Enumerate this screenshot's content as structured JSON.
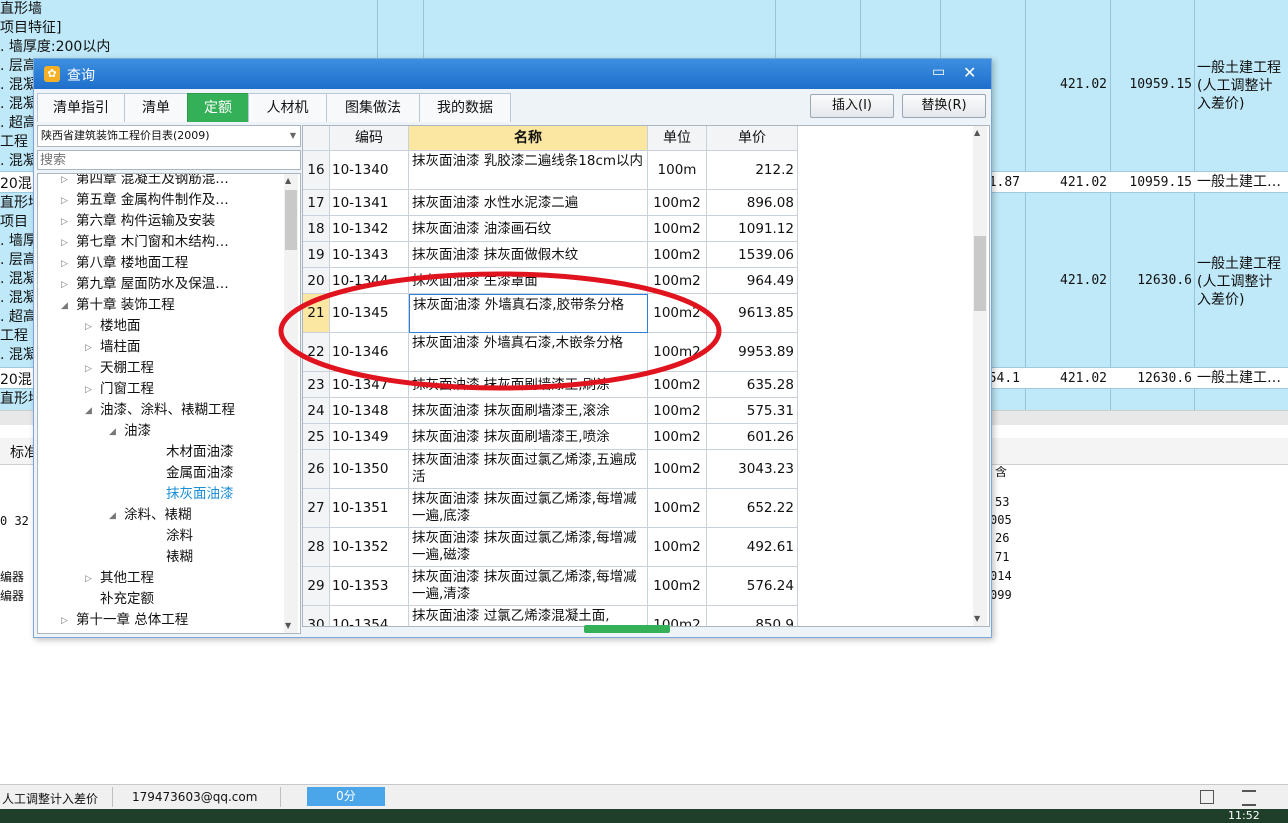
{
  "background": {
    "left_texts": [
      "直形墙",
      "项目特征]",
      ". 墙厚度:200以内",
      ". 层高",
      ". 混凝",
      ". 混凝",
      ". 超高",
      "工程",
      ". 混凝",
      "20混",
      "直形墙",
      "项目",
      ". 墙厚",
      ". 层高",
      ". 混凝",
      ". 混凝",
      ". 超高",
      "工程",
      ". 混凝",
      "20混",
      "直形墙"
    ],
    "rows": [
      {
        "col_a": "",
        "price": "421.02",
        "total": "10959.15",
        "desc": "一般土建工程\n(人工调整计\n入差价)"
      },
      {
        "col_a": "1.87",
        "price": "421.02",
        "total": "10959.15",
        "desc": "一般土建工…"
      },
      {
        "col_a": "",
        "price": "421.02",
        "total": "12630.6",
        "desc": "一般土建工程\n(人工调整计\n入差价)"
      },
      {
        "col_a": "54.1",
        "price": "421.02",
        "total": "12630.6",
        "desc": "一般土建工…"
      }
    ],
    "lower_tab": "标准",
    "lower_left": [
      "0 32",
      "编器",
      "编器"
    ],
    "lower_right": [
      "含",
      "53",
      "005",
      "26",
      "71",
      "014",
      "099"
    ]
  },
  "statusbar": {
    "left_text": "人工调整计入差价",
    "email": "179473603@qq.com",
    "progress_text": "0分",
    "clock": "11:52"
  },
  "dialog": {
    "title": "查询",
    "tabs": [
      {
        "label": "清单指引",
        "active": false
      },
      {
        "label": "清单",
        "active": false
      },
      {
        "label": "定额",
        "active": true
      },
      {
        "label": "人材机",
        "active": false
      },
      {
        "label": "图集做法",
        "active": false
      },
      {
        "label": "我的数据",
        "active": false
      }
    ],
    "insert_button": "插入(I)",
    "replace_button": "替换(R)",
    "catalog": "陕西省建筑装饰工程价目表(2009)",
    "search_placeholder": "搜索",
    "tree": [
      {
        "label": "第四章  混凝土及钢筋混…",
        "level": 1,
        "expand": "collapsed"
      },
      {
        "label": "第五章  金属构件制作及…",
        "level": 1,
        "expand": "collapsed"
      },
      {
        "label": "第六章  构件运输及安装",
        "level": 1,
        "expand": "collapsed"
      },
      {
        "label": "第七章  木门窗和木结构…",
        "level": 1,
        "expand": "collapsed"
      },
      {
        "label": "第八章  楼地面工程",
        "level": 1,
        "expand": "collapsed"
      },
      {
        "label": "第九章  屋面防水及保温…",
        "level": 1,
        "expand": "collapsed"
      },
      {
        "label": "第十章  装饰工程",
        "level": 1,
        "expand": "expanded"
      },
      {
        "label": "楼地面",
        "level": 2,
        "expand": "collapsed"
      },
      {
        "label": "墙柱面",
        "level": 2,
        "expand": "collapsed"
      },
      {
        "label": "天棚工程",
        "level": 2,
        "expand": "collapsed"
      },
      {
        "label": "门窗工程",
        "level": 2,
        "expand": "collapsed"
      },
      {
        "label": "油漆、涂料、裱糊工程",
        "level": 2,
        "expand": "expanded"
      },
      {
        "label": "油漆",
        "level": 3,
        "expand": "expanded"
      },
      {
        "label": "木材面油漆",
        "level": 4,
        "expand": "none"
      },
      {
        "label": "金属面油漆",
        "level": 4,
        "expand": "none"
      },
      {
        "label": "抹灰面油漆",
        "level": 4,
        "expand": "none",
        "selected": true
      },
      {
        "label": "涂料、裱糊",
        "level": 3,
        "expand": "expanded"
      },
      {
        "label": "涂料",
        "level": 4,
        "expand": "none"
      },
      {
        "label": "裱糊",
        "level": 4,
        "expand": "none"
      },
      {
        "label": "其他工程",
        "level": 2,
        "expand": "collapsed"
      },
      {
        "label": "补充定额",
        "level": 2,
        "expand": "none"
      },
      {
        "label": "第十一章  总体工程",
        "level": 1,
        "expand": "collapsed"
      }
    ],
    "table": {
      "headers": [
        "编码",
        "名称",
        "单位",
        "单价"
      ],
      "rows": [
        {
          "no": "16",
          "code": "10-1340",
          "name": "抹灰面油漆  乳胶漆二遍线条18cm以内",
          "unit": "100m",
          "price": "212.2",
          "tall": true
        },
        {
          "no": "17",
          "code": "10-1341",
          "name": "抹灰面油漆  水性水泥漆二遍",
          "unit": "100m2",
          "price": "896.08"
        },
        {
          "no": "18",
          "code": "10-1342",
          "name": "抹灰面油漆  油漆画石纹",
          "unit": "100m2",
          "price": "1091.12"
        },
        {
          "no": "19",
          "code": "10-1343",
          "name": "抹灰面油漆  抹灰面做假木纹",
          "unit": "100m2",
          "price": "1539.06"
        },
        {
          "no": "20",
          "code": "10-1344",
          "name": "抹灰面油漆  生漆罩面",
          "unit": "100m2",
          "price": "964.49"
        },
        {
          "no": "21",
          "code": "10-1345",
          "name": "抹灰面油漆  外墙真石漆,胶带条分格",
          "unit": "100m2",
          "price": "9613.85",
          "tall": true,
          "selected": true
        },
        {
          "no": "22",
          "code": "10-1346",
          "name": "抹灰面油漆  外墙真石漆,木嵌条分格",
          "unit": "100m2",
          "price": "9953.89",
          "tall": true
        },
        {
          "no": "23",
          "code": "10-1347",
          "name": "抹灰面油漆  抹灰面刷墙漆王,刷涂",
          "unit": "100m2",
          "price": "635.28"
        },
        {
          "no": "24",
          "code": "10-1348",
          "name": "抹灰面油漆  抹灰面刷墙漆王,滚涂",
          "unit": "100m2",
          "price": "575.31"
        },
        {
          "no": "25",
          "code": "10-1349",
          "name": "抹灰面油漆  抹灰面刷墙漆王,喷涂",
          "unit": "100m2",
          "price": "601.26"
        },
        {
          "no": "26",
          "code": "10-1350",
          "name": "抹灰面油漆  抹灰面过氯乙烯漆,五遍成活",
          "unit": "100m2",
          "price": "3043.23",
          "tall": true
        },
        {
          "no": "27",
          "code": "10-1351",
          "name": "抹灰面油漆  抹灰面过氯乙烯漆,每增减一遍,底漆",
          "unit": "100m2",
          "price": "652.22",
          "tall": true
        },
        {
          "no": "28",
          "code": "10-1352",
          "name": "抹灰面油漆  抹灰面过氯乙烯漆,每增减一遍,磁漆",
          "unit": "100m2",
          "price": "492.61",
          "tall": true
        },
        {
          "no": "29",
          "code": "10-1353",
          "name": "抹灰面油漆  抹灰面过氯乙烯漆,每增减一遍,清漆",
          "unit": "100m2",
          "price": "576.24",
          "tall": true
        },
        {
          "no": "30",
          "code": "10-1354",
          "name": "抹灰面油漆  过氯乙烯漆混凝土面,",
          "unit": "100m2",
          "price": "850.9",
          "tall": true,
          "partial": true
        }
      ]
    }
  },
  "colors": {
    "accent_green": "#34b158",
    "title_blue": "#1e6fcc",
    "highlight_red": "#e0141e",
    "header_yellow": "#fbe7a1"
  }
}
